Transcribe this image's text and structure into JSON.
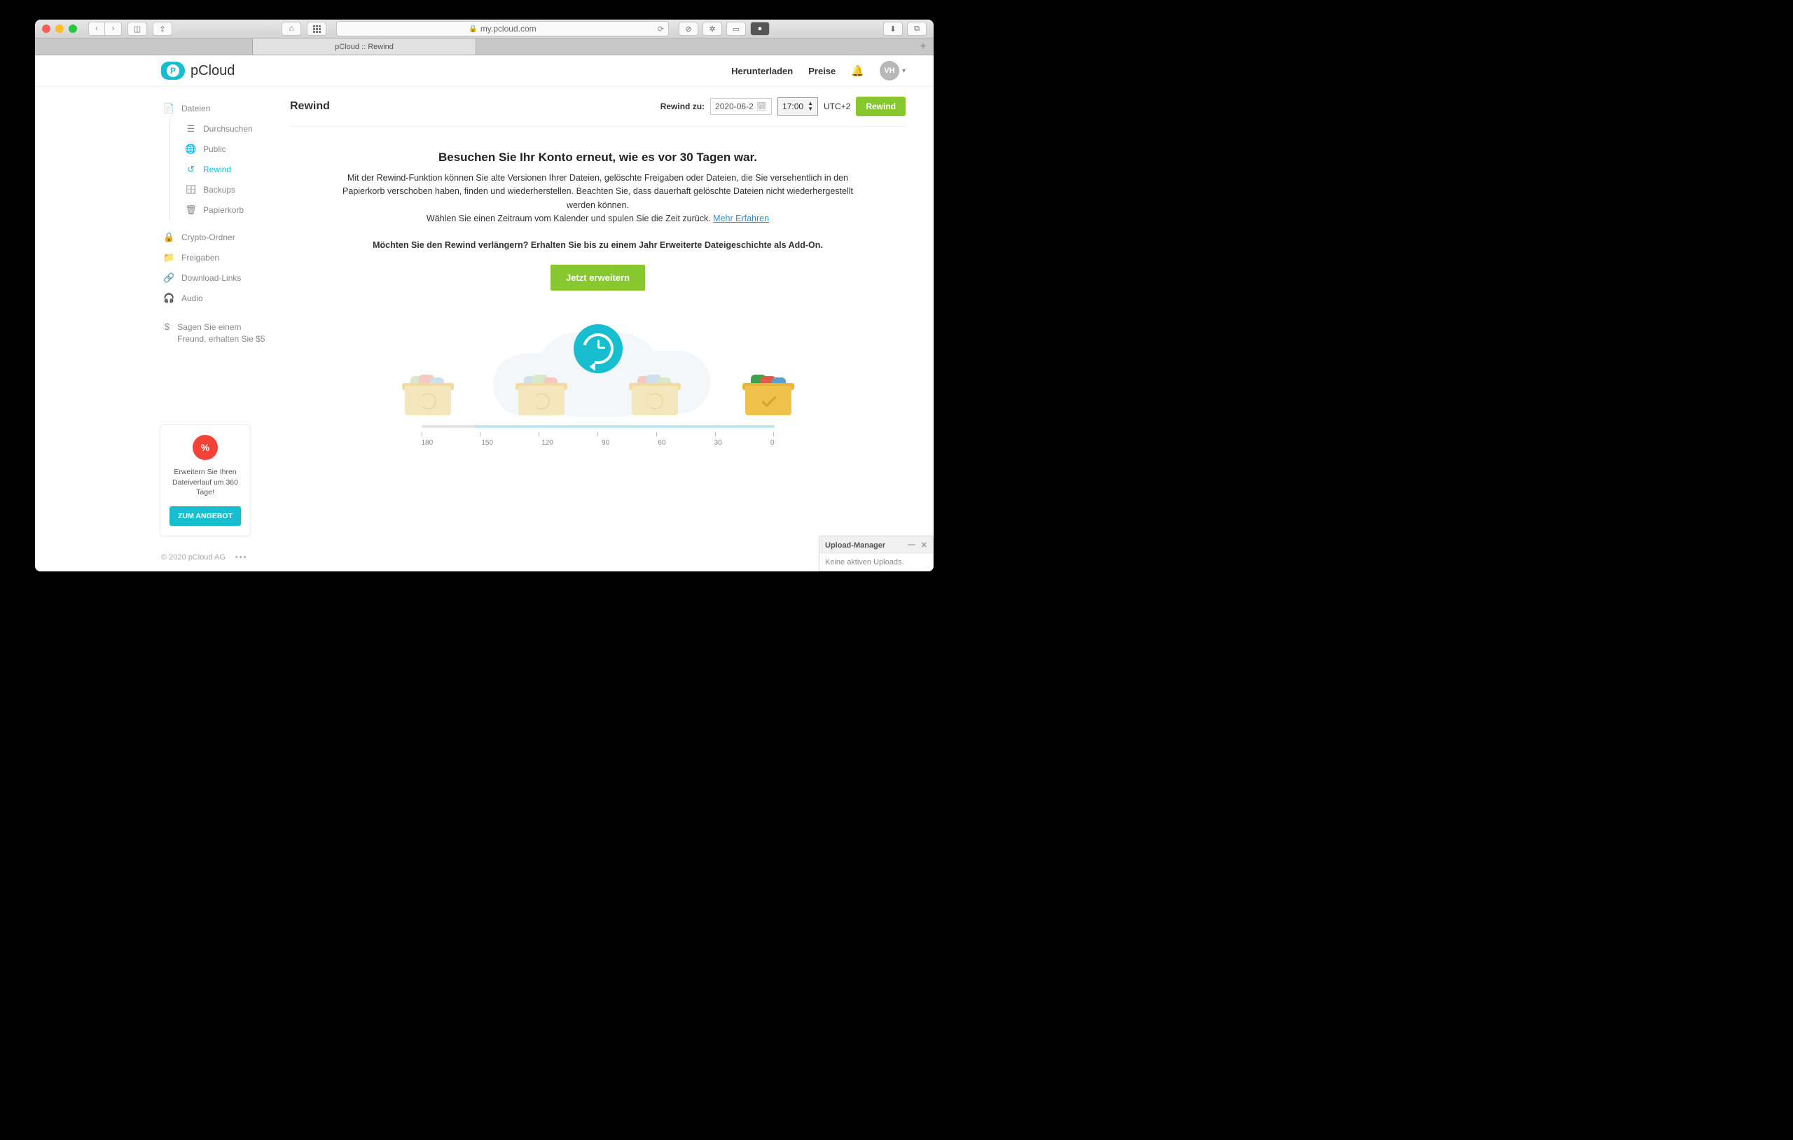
{
  "browser": {
    "url": "my.pcloud.com",
    "tab_title": "pCloud :: Rewind"
  },
  "brand": "pCloud",
  "topnav": {
    "download": "Herunterladen",
    "pricing": "Preise",
    "avatar": "VH"
  },
  "sidebar": {
    "files": "Dateien",
    "browse": "Durchsuchen",
    "public": "Public",
    "rewind": "Rewind",
    "backups": "Backups",
    "trash": "Papierkorb",
    "crypto": "Crypto-Ordner",
    "shares": "Freigaben",
    "links": "Download-Links",
    "audio": "Audio",
    "referral": "Sagen Sie einem Freund, erhalten Sie $5"
  },
  "page": {
    "title": "Rewind",
    "rewind_to_label": "Rewind zu:",
    "date_value": "2020-06-2",
    "time_value": "17:00",
    "timezone": "UTC+2",
    "rewind_button": "Rewind"
  },
  "hero": {
    "heading": "Besuchen Sie Ihr Konto erneut, wie es vor 30 Tagen war.",
    "body_line1": "Mit der Rewind-Funktion können Sie alte Versionen Ihrer Dateien, gelöschte Freigaben oder Dateien, die Sie versehentlich in den Papierkorb verschoben haben, finden und wiederherstellen. Beachten Sie, dass dauerhaft gelöschte Dateien nicht wiederhergestellt werden können.",
    "body_line2_prefix": "Wählen Sie einen Zeitraum vom Kalender und spulen Sie die Zeit zurück. ",
    "learn_more": "Mehr Erfahren",
    "sub2": "Möchten Sie den Rewind verlängern? Erhalten Sie bis zu einem Jahr Erweiterte Dateigeschichte als Add-On.",
    "extend_button": "Jetzt erweitern"
  },
  "timeline": {
    "labels": [
      "180",
      "150",
      "120",
      "90",
      "60",
      "30",
      "0"
    ]
  },
  "promo": {
    "badge": "%",
    "text": "Erweitern Sie Ihren Dateiverlauf um 360 Tage!",
    "button": "ZUM ANGEBOT"
  },
  "footer": {
    "copyright": "© 2020 pCloud AG"
  },
  "upload_manager": {
    "title": "Upload-Manager",
    "status": "Keine aktiven Uploads."
  }
}
